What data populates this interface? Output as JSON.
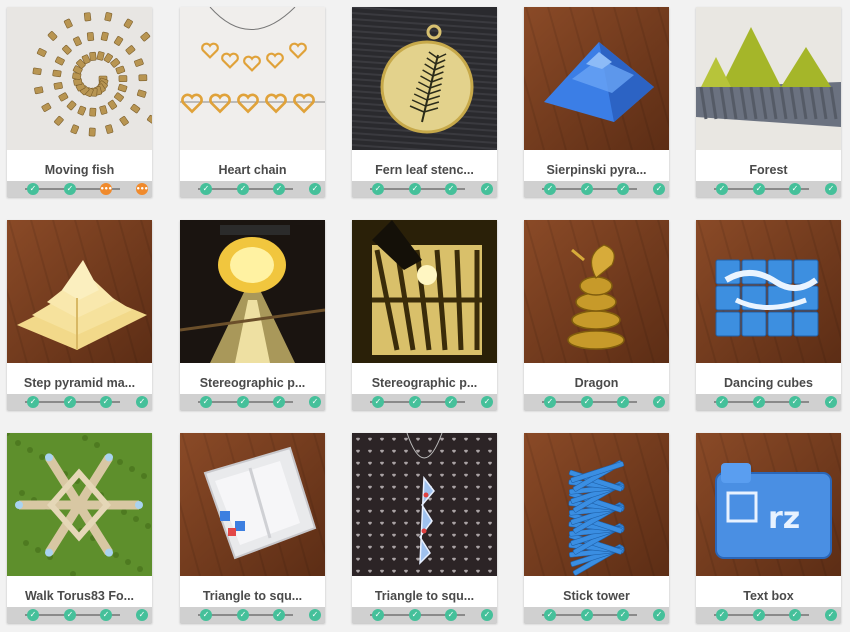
{
  "accent": {
    "done": "#45c09a",
    "pending": "#f08a2c"
  },
  "cards": [
    {
      "title": "Moving fish",
      "image": "spiral-chain-photo",
      "steps": [
        "done",
        "done",
        "pending",
        "pending"
      ]
    },
    {
      "title": "Heart chain",
      "image": "heart-necklace-photo",
      "steps": [
        "done",
        "done",
        "done",
        "done"
      ]
    },
    {
      "title": "Fern leaf stenc...",
      "image": "fern-pendant-photo",
      "steps": [
        "done",
        "done",
        "done",
        "done"
      ]
    },
    {
      "title": "Sierpinski pyra...",
      "image": "blue-pyramid-photo",
      "steps": [
        "done",
        "done",
        "done",
        "done"
      ]
    },
    {
      "title": "Forest",
      "image": "fractal-trees-photo",
      "steps": [
        "done",
        "done",
        "done",
        "done"
      ]
    },
    {
      "title": "Step pyramid ma...",
      "image": "yellow-pyramid-photo",
      "steps": [
        "done",
        "done",
        "done",
        "done"
      ]
    },
    {
      "title": "Stereographic p...",
      "image": "lamp-projection-photo",
      "steps": [
        "done",
        "done",
        "done",
        "done"
      ]
    },
    {
      "title": "Stereographic p...",
      "image": "shadow-pattern-photo",
      "steps": [
        "done",
        "done",
        "done",
        "done"
      ]
    },
    {
      "title": "Dragon",
      "image": "gold-dragon-photo",
      "steps": [
        "done",
        "done",
        "done",
        "done"
      ]
    },
    {
      "title": "Dancing cubes",
      "image": "blue-cubes-photo",
      "steps": [
        "done",
        "done",
        "done",
        "done"
      ]
    },
    {
      "title": "Walk Torus83 Fo...",
      "image": "star-castle-photo",
      "steps": [
        "done",
        "done",
        "done",
        "done"
      ]
    },
    {
      "title": "Triangle to squ...",
      "image": "white-box-photo",
      "steps": [
        "done",
        "done",
        "done",
        "done"
      ]
    },
    {
      "title": "Triangle to squ...",
      "image": "pendant-chain-photo",
      "steps": [
        "done",
        "done",
        "done",
        "done"
      ]
    },
    {
      "title": "Stick tower",
      "image": "twisted-tower-photo",
      "steps": [
        "done",
        "done",
        "done",
        "done"
      ]
    },
    {
      "title": "Text box",
      "image": "blue-text-box-photo",
      "steps": [
        "done",
        "done",
        "done",
        "done"
      ]
    }
  ]
}
